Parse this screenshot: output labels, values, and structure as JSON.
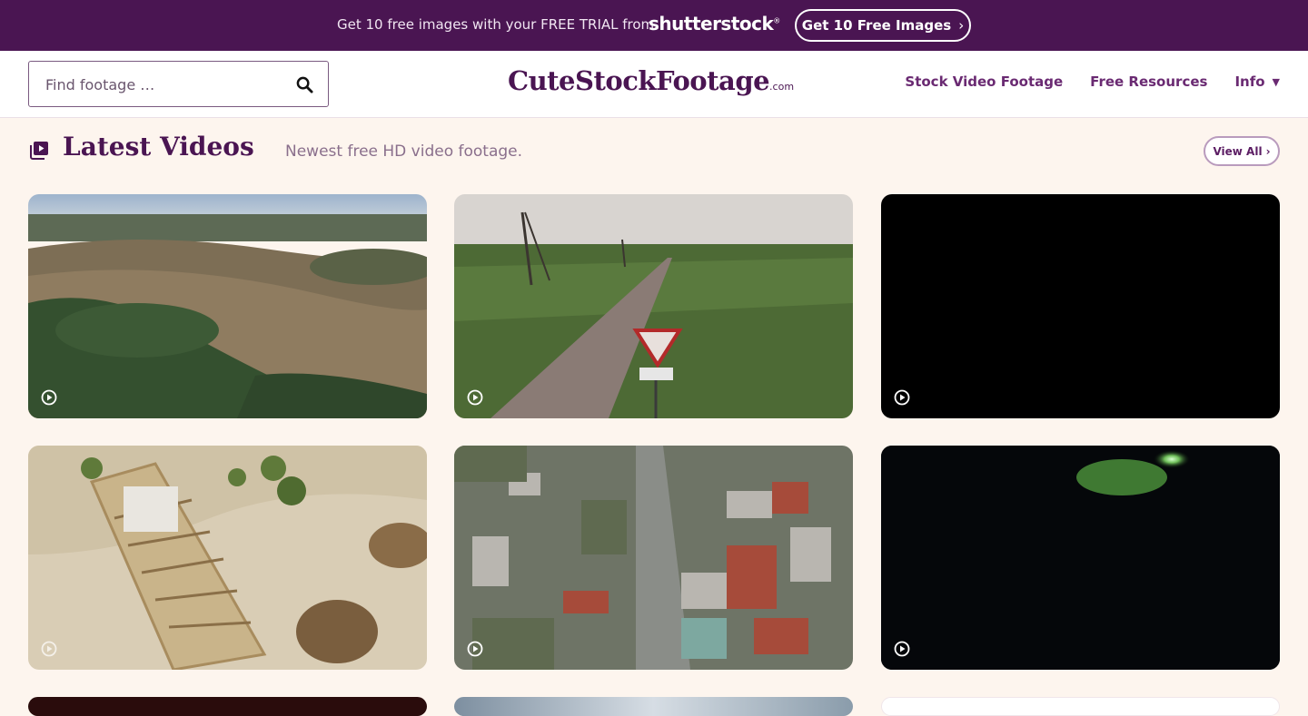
{
  "promo": {
    "text": "Get 10 free images with your FREE TRIAL from",
    "brand": "shutterstock",
    "brand_mark": "®",
    "button_label": "Get 10 Free Images",
    "button_chevron": "›"
  },
  "header": {
    "search": {
      "placeholder": "Find footage …",
      "value": ""
    },
    "logo": {
      "name": "CuteStockFootage",
      "tld": ".com"
    },
    "nav": [
      {
        "label": "Stock Video Footage"
      },
      {
        "label": "Free Resources"
      },
      {
        "label": "Info"
      }
    ]
  },
  "section": {
    "title": "Latest Videos",
    "subtitle": "Newest free HD video footage.",
    "view_all_label": "View All",
    "view_all_chevron": "›"
  },
  "videos": [
    {
      "scene": "aerial-forest-hills",
      "icon": "play-icon"
    },
    {
      "scene": "country-road-yield-sign",
      "icon": "play-icon"
    },
    {
      "scene": "black-frame",
      "icon": "play-icon"
    },
    {
      "scene": "wooden-structure-sand",
      "icon": "play-icon"
    },
    {
      "scene": "aerial-town-market",
      "icon": "play-icon"
    },
    {
      "scene": "dark-night-light",
      "icon": "play-icon"
    },
    {
      "scene": "dark-red",
      "icon": "play-icon"
    },
    {
      "scene": "sky",
      "icon": "play-icon"
    },
    {
      "scene": "white",
      "icon": "play-icon"
    }
  ],
  "colors": {
    "promo_bg": "#4a1552",
    "page_bg": "#fdf5ee",
    "brand_purple": "#4a1552",
    "nav_purple": "#6a2a72"
  }
}
